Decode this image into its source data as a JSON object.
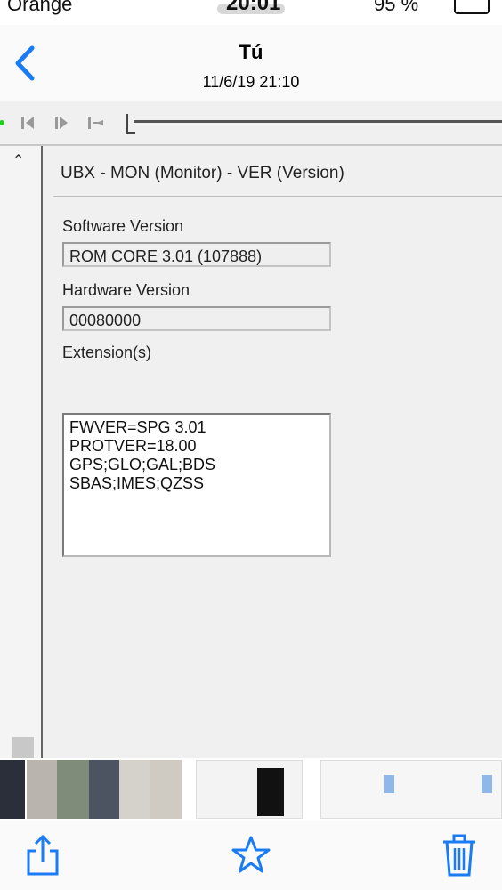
{
  "status_bar": {
    "carrier": "Orange",
    "time": "20:01",
    "battery": "95 %"
  },
  "header": {
    "title": "Tú",
    "subtitle": "11/6/19 21:10"
  },
  "photo": {
    "window_title": "UBX - MON (Monitor) - VER (Version)",
    "software_label": "Software Version",
    "software_value": "ROM CORE 3.01 (107888)",
    "hardware_label": "Hardware Version",
    "hardware_value": "00080000",
    "extensions_label": "Extension(s)",
    "extensions": [
      "FWVER=SPG 3.01",
      "PROTVER=18.00",
      "GPS;GLO;GAL;BDS",
      "SBAS;IMES;QZSS"
    ]
  },
  "colors": {
    "accent": "#1a7cf5",
    "window_bg": "#f0f0f0"
  },
  "icons": [
    "back-chevron-icon",
    "share-icon",
    "favorite-star-icon",
    "trash-icon"
  ]
}
